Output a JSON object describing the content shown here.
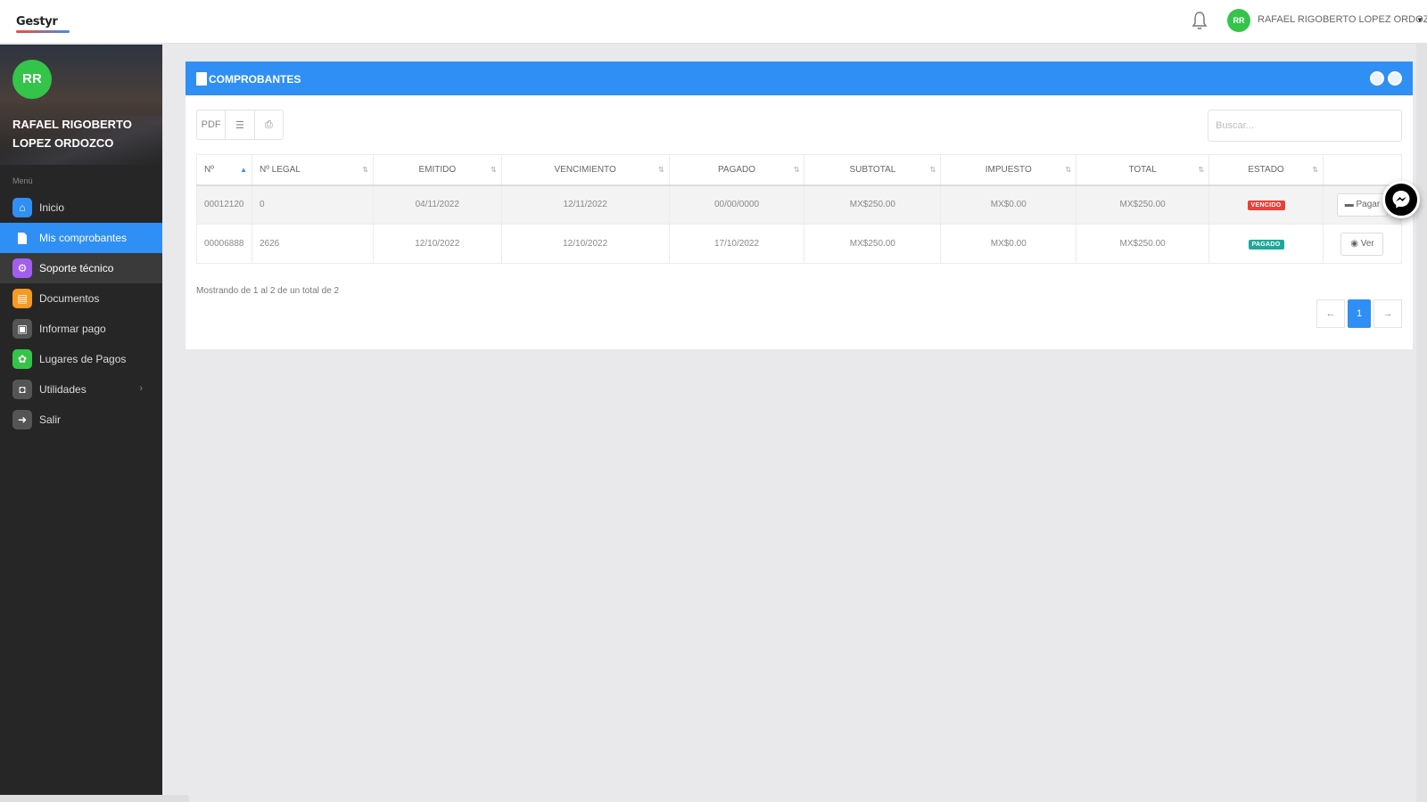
{
  "topbar": {
    "logo_text": "Gestyr",
    "user_initials": "RR",
    "user_name": "RAFAEL RIGOBERTO LOPEZ ORDOZCO"
  },
  "sidebar": {
    "avatar_initials": "RR",
    "user_name": "RAFAEL RIGOBERTO LOPEZ ORDOZCO",
    "menu_label": "Menú",
    "items": [
      {
        "label": "Inicio",
        "icon": "home-icon",
        "color": "#2f8ff5"
      },
      {
        "label": "Mis comprobantes",
        "icon": "document-icon",
        "color": "#2f8ff5",
        "active": true
      },
      {
        "label": "Soporte técnico",
        "icon": "support-icon",
        "color": "#a35ef0"
      },
      {
        "label": "Documentos",
        "icon": "file-icon",
        "color": "#f59a23"
      },
      {
        "label": "Informar pago",
        "icon": "image-icon",
        "color": "#555555"
      },
      {
        "label": "Lugares de Pagos",
        "icon": "store-icon",
        "color": "#35c44a"
      },
      {
        "label": "Utilidades",
        "icon": "briefcase-icon",
        "color": "#555555"
      },
      {
        "label": "Salir",
        "icon": "exit-icon",
        "color": "#555555"
      }
    ]
  },
  "panel": {
    "title": "COMPROBANTES",
    "search_placeholder": "Buscar...",
    "toolbar": {
      "pdf_label": "PDF",
      "list_label": "☰",
      "export_label": "⎙"
    },
    "columns": [
      "Nº",
      "Nº LEGAL",
      "EMITIDO",
      "VENCIMIENTO",
      "PAGADO",
      "SUBTOTAL",
      "IMPUESTO",
      "TOTAL",
      "ESTADO",
      ""
    ],
    "rows": [
      {
        "numero": "00012120",
        "legal": "0",
        "emitido": "04/11/2022",
        "vencimiento": "12/11/2022",
        "pagado": "00/00/0000",
        "subtotal": "MX$250.00",
        "impuesto": "MX$0.00",
        "total": "MX$250.00",
        "estado": "VENCIDO",
        "estado_color": "#e8413a",
        "accion": "Pagar"
      },
      {
        "numero": "00006888",
        "legal": "2626",
        "emitido": "12/10/2022",
        "vencimiento": "12/10/2022",
        "pagado": "17/10/2022",
        "subtotal": "MX$250.00",
        "impuesto": "MX$0.00",
        "total": "MX$250.00",
        "estado": "PAGADO",
        "estado_color": "#1fa89a",
        "accion": "Ver"
      }
    ],
    "info_text": "Mostrando de 1 al 2 de un total de 2",
    "pagination": {
      "prev": "←",
      "current": "1",
      "next": "→"
    }
  },
  "colors": {
    "accent": "#2f8ff5",
    "sidebar_bg": "#262626",
    "avatar": "#35c44a"
  }
}
